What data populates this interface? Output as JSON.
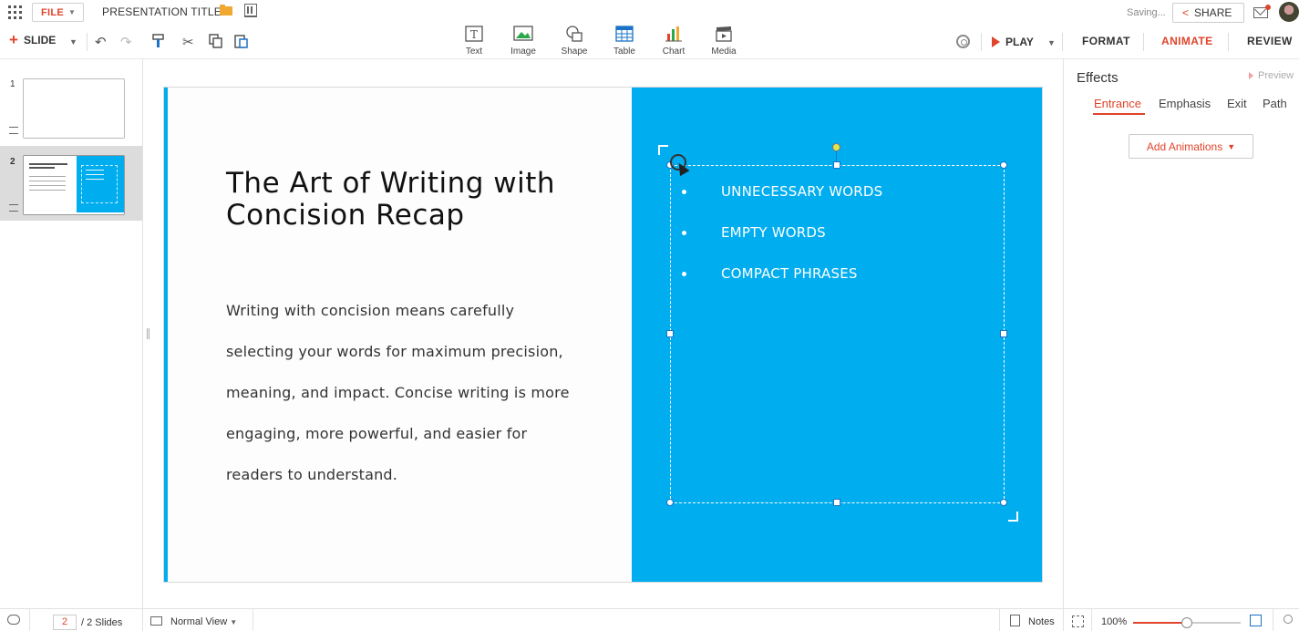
{
  "header": {
    "file_label": "FILE",
    "presentation_title": "PRESENTATION TITLE",
    "saving_status": "Saving...",
    "share_label": "SHARE"
  },
  "toolbar": {
    "slide_label": "SLIDE",
    "insert": [
      {
        "label": "Text",
        "icon": "text-box-icon"
      },
      {
        "label": "Image",
        "icon": "image-icon"
      },
      {
        "label": "Shape",
        "icon": "shape-icon"
      },
      {
        "label": "Table",
        "icon": "table-icon"
      },
      {
        "label": "Chart",
        "icon": "chart-icon"
      },
      {
        "label": "Media",
        "icon": "media-icon"
      }
    ],
    "play_label": "PLAY",
    "tabs": [
      "FORMAT",
      "ANIMATE",
      "REVIEW"
    ],
    "active_tab": "ANIMATE"
  },
  "thumbnails": [
    {
      "number": "1"
    },
    {
      "number": "2"
    }
  ],
  "slide": {
    "title": "The Art of Writing with Concision Recap",
    "body": "Writing with concision means carefully selecting your words for maximum precision, meaning, and impact. Concise writing is more engaging, more powerful, and easier for readers to understand.",
    "bullets": [
      "UNNECESSARY WORDS",
      "EMPTY WORDS",
      "COMPACT PHRASES"
    ]
  },
  "panel": {
    "title": "Effects",
    "preview_label": "Preview",
    "tabs": [
      "Entrance",
      "Emphasis",
      "Exit",
      "Path"
    ],
    "active_tab": "Entrance",
    "add_button": "Add Animations"
  },
  "status": {
    "current_page": "2",
    "total_pages": "/ 2 Slides",
    "view_label": "Normal View",
    "notes_label": "Notes",
    "zoom_label": "100%",
    "zoom_fraction": 0.5
  },
  "colors": {
    "accent": "#e0442b",
    "slide_blue": "#00adef"
  }
}
